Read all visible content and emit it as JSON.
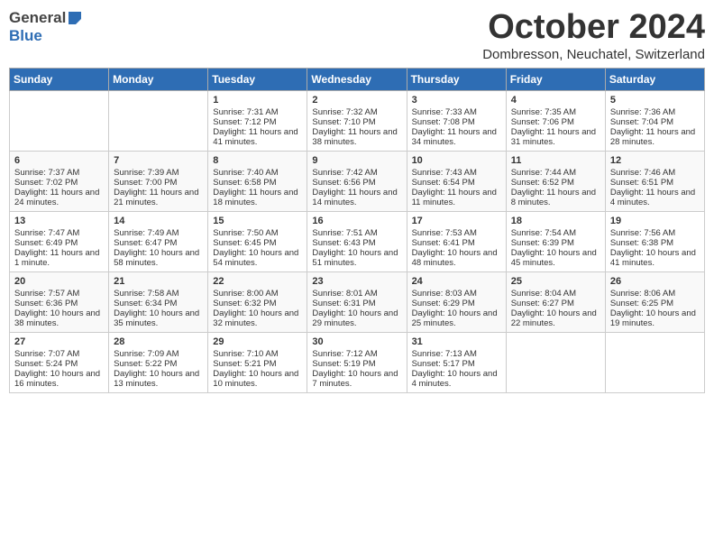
{
  "header": {
    "logo_general": "General",
    "logo_blue": "Blue",
    "month": "October 2024",
    "location": "Dombresson, Neuchatel, Switzerland"
  },
  "days_of_week": [
    "Sunday",
    "Monday",
    "Tuesday",
    "Wednesday",
    "Thursday",
    "Friday",
    "Saturday"
  ],
  "weeks": [
    [
      {
        "day": "",
        "info": ""
      },
      {
        "day": "",
        "info": ""
      },
      {
        "day": "1",
        "info": "Sunrise: 7:31 AM\nSunset: 7:12 PM\nDaylight: 11 hours and 41 minutes."
      },
      {
        "day": "2",
        "info": "Sunrise: 7:32 AM\nSunset: 7:10 PM\nDaylight: 11 hours and 38 minutes."
      },
      {
        "day": "3",
        "info": "Sunrise: 7:33 AM\nSunset: 7:08 PM\nDaylight: 11 hours and 34 minutes."
      },
      {
        "day": "4",
        "info": "Sunrise: 7:35 AM\nSunset: 7:06 PM\nDaylight: 11 hours and 31 minutes."
      },
      {
        "day": "5",
        "info": "Sunrise: 7:36 AM\nSunset: 7:04 PM\nDaylight: 11 hours and 28 minutes."
      }
    ],
    [
      {
        "day": "6",
        "info": "Sunrise: 7:37 AM\nSunset: 7:02 PM\nDaylight: 11 hours and 24 minutes."
      },
      {
        "day": "7",
        "info": "Sunrise: 7:39 AM\nSunset: 7:00 PM\nDaylight: 11 hours and 21 minutes."
      },
      {
        "day": "8",
        "info": "Sunrise: 7:40 AM\nSunset: 6:58 PM\nDaylight: 11 hours and 18 minutes."
      },
      {
        "day": "9",
        "info": "Sunrise: 7:42 AM\nSunset: 6:56 PM\nDaylight: 11 hours and 14 minutes."
      },
      {
        "day": "10",
        "info": "Sunrise: 7:43 AM\nSunset: 6:54 PM\nDaylight: 11 hours and 11 minutes."
      },
      {
        "day": "11",
        "info": "Sunrise: 7:44 AM\nSunset: 6:52 PM\nDaylight: 11 hours and 8 minutes."
      },
      {
        "day": "12",
        "info": "Sunrise: 7:46 AM\nSunset: 6:51 PM\nDaylight: 11 hours and 4 minutes."
      }
    ],
    [
      {
        "day": "13",
        "info": "Sunrise: 7:47 AM\nSunset: 6:49 PM\nDaylight: 11 hours and 1 minute."
      },
      {
        "day": "14",
        "info": "Sunrise: 7:49 AM\nSunset: 6:47 PM\nDaylight: 10 hours and 58 minutes."
      },
      {
        "day": "15",
        "info": "Sunrise: 7:50 AM\nSunset: 6:45 PM\nDaylight: 10 hours and 54 minutes."
      },
      {
        "day": "16",
        "info": "Sunrise: 7:51 AM\nSunset: 6:43 PM\nDaylight: 10 hours and 51 minutes."
      },
      {
        "day": "17",
        "info": "Sunrise: 7:53 AM\nSunset: 6:41 PM\nDaylight: 10 hours and 48 minutes."
      },
      {
        "day": "18",
        "info": "Sunrise: 7:54 AM\nSunset: 6:39 PM\nDaylight: 10 hours and 45 minutes."
      },
      {
        "day": "19",
        "info": "Sunrise: 7:56 AM\nSunset: 6:38 PM\nDaylight: 10 hours and 41 minutes."
      }
    ],
    [
      {
        "day": "20",
        "info": "Sunrise: 7:57 AM\nSunset: 6:36 PM\nDaylight: 10 hours and 38 minutes."
      },
      {
        "day": "21",
        "info": "Sunrise: 7:58 AM\nSunset: 6:34 PM\nDaylight: 10 hours and 35 minutes."
      },
      {
        "day": "22",
        "info": "Sunrise: 8:00 AM\nSunset: 6:32 PM\nDaylight: 10 hours and 32 minutes."
      },
      {
        "day": "23",
        "info": "Sunrise: 8:01 AM\nSunset: 6:31 PM\nDaylight: 10 hours and 29 minutes."
      },
      {
        "day": "24",
        "info": "Sunrise: 8:03 AM\nSunset: 6:29 PM\nDaylight: 10 hours and 25 minutes."
      },
      {
        "day": "25",
        "info": "Sunrise: 8:04 AM\nSunset: 6:27 PM\nDaylight: 10 hours and 22 minutes."
      },
      {
        "day": "26",
        "info": "Sunrise: 8:06 AM\nSunset: 6:25 PM\nDaylight: 10 hours and 19 minutes."
      }
    ],
    [
      {
        "day": "27",
        "info": "Sunrise: 7:07 AM\nSunset: 5:24 PM\nDaylight: 10 hours and 16 minutes."
      },
      {
        "day": "28",
        "info": "Sunrise: 7:09 AM\nSunset: 5:22 PM\nDaylight: 10 hours and 13 minutes."
      },
      {
        "day": "29",
        "info": "Sunrise: 7:10 AM\nSunset: 5:21 PM\nDaylight: 10 hours and 10 minutes."
      },
      {
        "day": "30",
        "info": "Sunrise: 7:12 AM\nSunset: 5:19 PM\nDaylight: 10 hours and 7 minutes."
      },
      {
        "day": "31",
        "info": "Sunrise: 7:13 AM\nSunset: 5:17 PM\nDaylight: 10 hours and 4 minutes."
      },
      {
        "day": "",
        "info": ""
      },
      {
        "day": "",
        "info": ""
      }
    ]
  ]
}
